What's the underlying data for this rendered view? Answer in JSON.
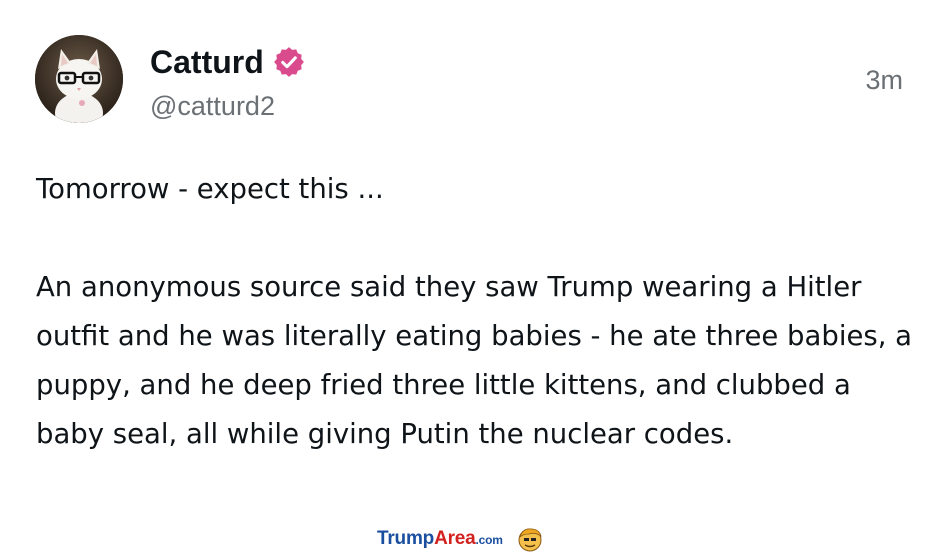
{
  "post": {
    "author": {
      "display_name": "Catturd",
      "handle": "@catturd2",
      "verified": true,
      "avatar_icon": "cat-with-glasses-avatar"
    },
    "timestamp": "3m",
    "paragraphs": [
      "Tomorrow - expect this ...",
      "An anonymous source said they saw Trump wearing a Hitler outfit and he was literally eating babies - he ate three babies, a puppy, and he deep fried three little kittens, and clubbed a baby seal, all while giving Putin the nuclear codes."
    ]
  },
  "watermark": {
    "part1": "Trump",
    "part2": "Area",
    "part3": ".com",
    "icon": "trump-face-logo-icon"
  },
  "colors": {
    "verified_badge": "#d94b8c",
    "text": "#0f1419",
    "muted": "#6b7075",
    "watermark_blue": "#1a4fa0",
    "watermark_red": "#d2221f"
  }
}
